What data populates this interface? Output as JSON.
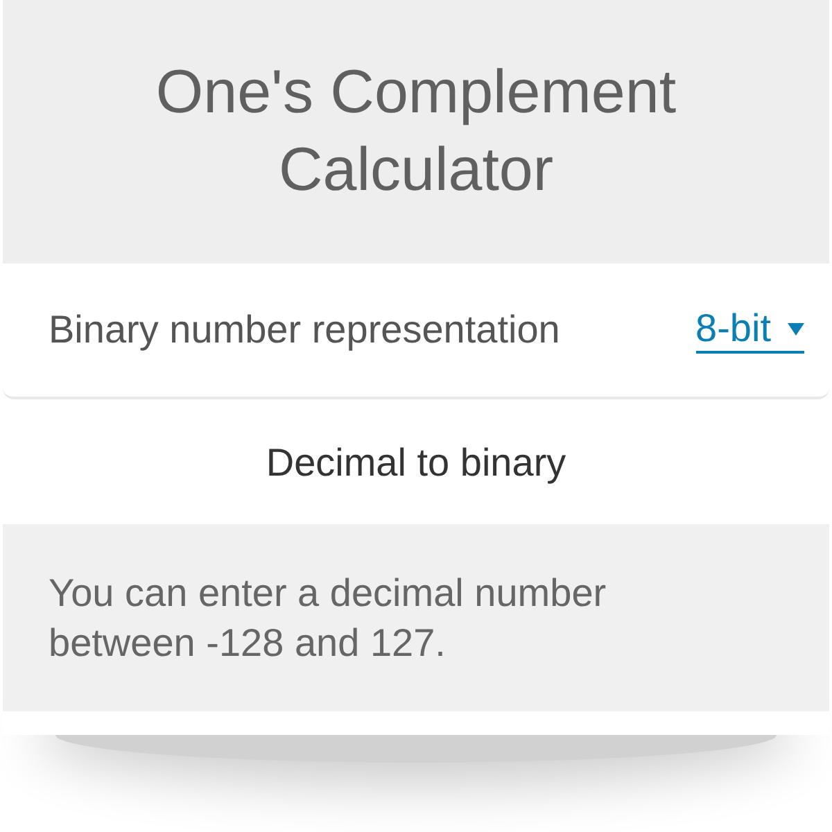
{
  "header": {
    "title": "One's Complement Calculator"
  },
  "setting": {
    "label": "Binary number representation",
    "value": "8-bit"
  },
  "section": {
    "title": "Decimal to binary"
  },
  "note": {
    "text": "You can enter a decimal number between -128 and 127."
  }
}
